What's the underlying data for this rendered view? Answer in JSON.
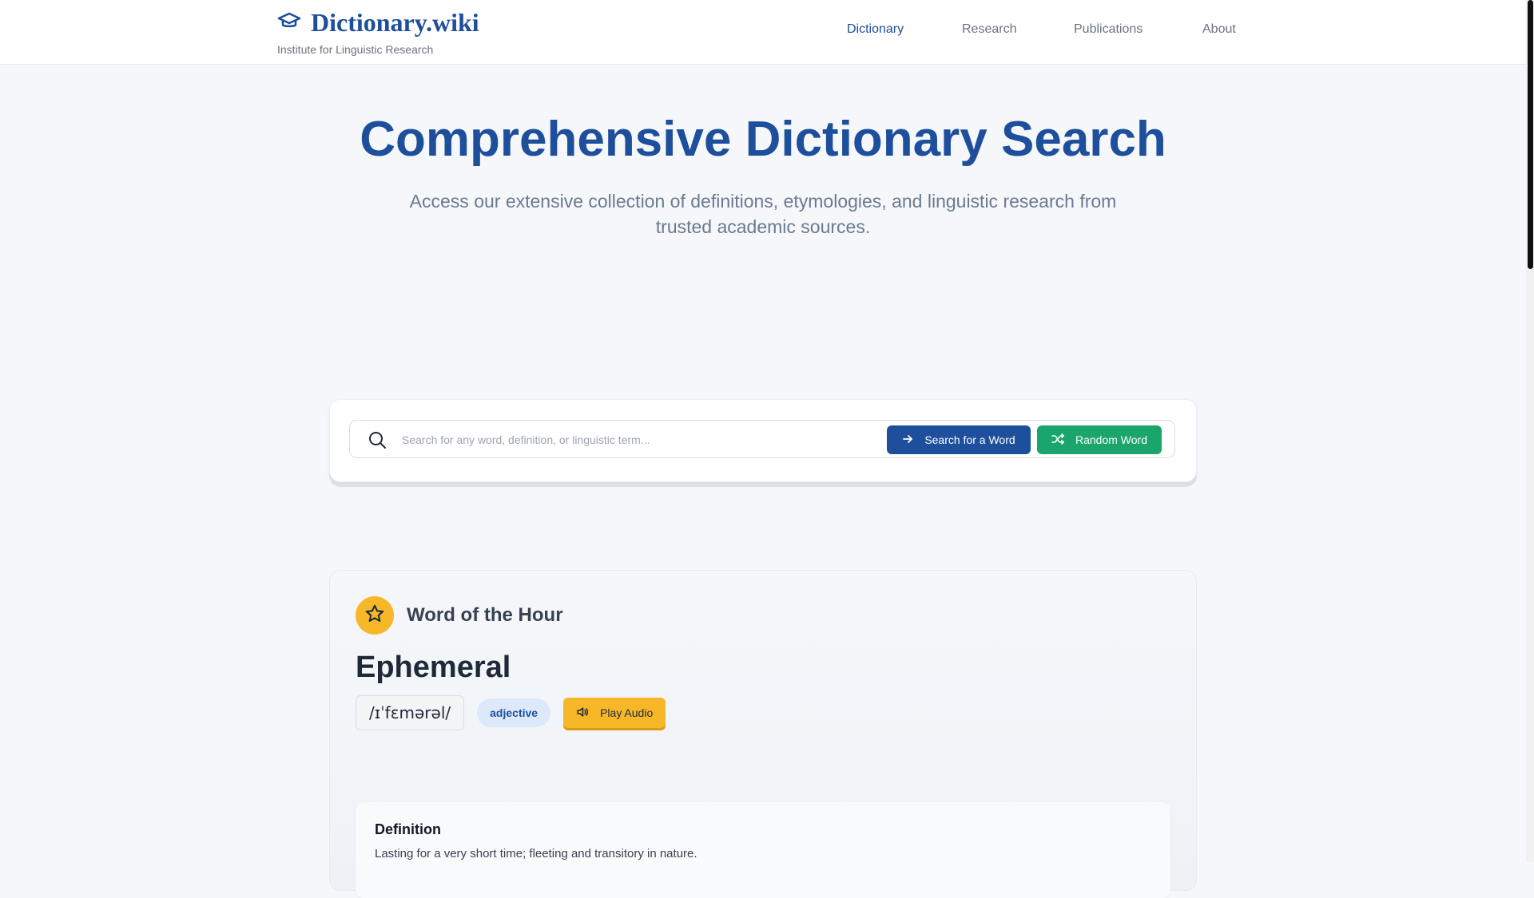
{
  "header": {
    "brand_title": "Dictionary.wiki",
    "brand_subtitle": "Institute for Linguistic Research",
    "nav": [
      {
        "label": "Dictionary",
        "active": true
      },
      {
        "label": "Research",
        "active": false
      },
      {
        "label": "Publications",
        "active": false
      },
      {
        "label": "About",
        "active": false
      }
    ]
  },
  "hero": {
    "title": "Comprehensive Dictionary Search",
    "subtitle": "Access our extensive collection of definitions, etymologies, and linguistic research from trusted academic sources."
  },
  "search": {
    "placeholder": "Search for any word, definition, or linguistic term...",
    "search_button": "Search for a Word",
    "random_button": "Random Word"
  },
  "word_of_hour": {
    "heading": "Word of the Hour",
    "word": "Ephemeral",
    "pronunciation": "/ɪˈfɛmərəl/",
    "part_of_speech": "adjective",
    "audio_button": "Play Audio",
    "definition_heading": "Definition",
    "definition_text": "Lasting for a very short time; fleeting and transitory in nature."
  },
  "colors": {
    "brand": "#1e4f9c",
    "accent_green": "#1aa56d",
    "accent_yellow": "#f6b828"
  },
  "icons": {
    "brand": "graduation-cap-icon",
    "search": "search-icon",
    "search_button": "arrow-right-icon",
    "random_button": "shuffle-icon",
    "word_of_hour": "star-icon",
    "audio": "speaker-icon"
  }
}
